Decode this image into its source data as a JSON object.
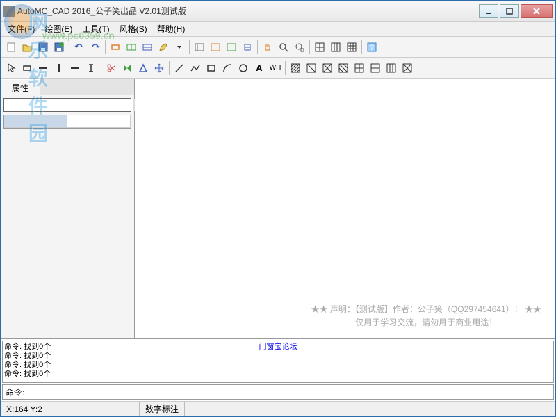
{
  "title": "AutoMC_CAD 2016_公子笑出品   V2.01测试版",
  "menu": [
    "文件(F)",
    "绘图(E)",
    "工具(T)",
    "风格(S)",
    "帮助(H)"
  ],
  "watermark": {
    "text": "网乐软件园",
    "url": "www.pc0359.cn"
  },
  "side": {
    "tab_label": "属性",
    "combo_value": ""
  },
  "canvas": {
    "line1": "★★ 声明：【测试版】作者：公子笑（QQ297454641）！ ★★",
    "line2": "仅用于学习交流，请勿用于商业用途！"
  },
  "cmd": {
    "link": "门窗宝论坛",
    "log": [
      "命令: 找到0个",
      "命令: 找到0个",
      "命令: 找到0个",
      "命令: 找到0个"
    ],
    "label": "命令:",
    "value": ""
  },
  "status": {
    "coords": "X:164  Y:2",
    "mode": "数字标注"
  },
  "colors": {
    "red": "#d04040",
    "green": "#40a040",
    "blue": "#4060c0",
    "orange": "#e08030",
    "yellow": "#d0b030",
    "purple": "#8040a0",
    "gray": "#707070"
  }
}
